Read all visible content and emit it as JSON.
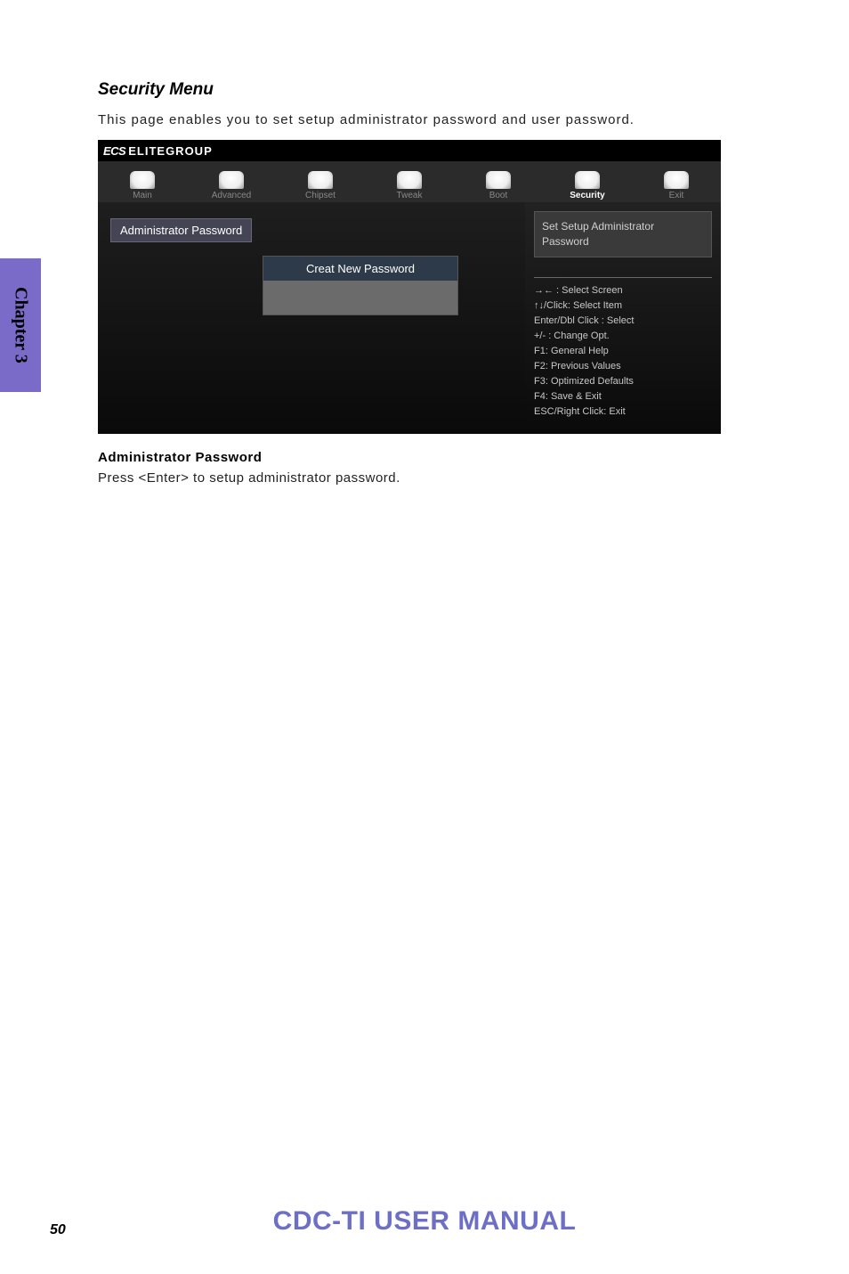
{
  "section_title": "Security Menu",
  "intro_text": "This page enables you to set setup administrator password and user password.",
  "bios": {
    "brand_logo": "ECS",
    "brand_name": "ELITEGROUP",
    "tabs": [
      {
        "label": "Main",
        "active": false
      },
      {
        "label": "Advanced",
        "active": false
      },
      {
        "label": "Chipset",
        "active": false
      },
      {
        "label": "Tweak",
        "active": false
      },
      {
        "label": "Boot",
        "active": false
      },
      {
        "label": "Security",
        "active": true
      },
      {
        "label": "Exit",
        "active": false
      }
    ],
    "left": {
      "admin_password_item": "Administrator  Password",
      "dialog_title": "Creat New  Password"
    },
    "right": {
      "help_text": "Set Setup Administrator Password",
      "legend": [
        "→←    : Select Screen",
        "↑↓/Click: Select Item",
        "Enter/Dbl Click : Select",
        "+/- : Change Opt.",
        "F1: General Help",
        "F2: Previous Values",
        "F3: Optimized Defaults",
        "F4: Save & Exit",
        "ESC/Right Click: Exit"
      ]
    }
  },
  "field_heading": "Administrator Password",
  "field_desc": "Press <Enter> to setup administrator password.",
  "chapter_tab": "Chapter 3",
  "footer_title": "CDC-TI USER MANUAL",
  "page_number": "50"
}
